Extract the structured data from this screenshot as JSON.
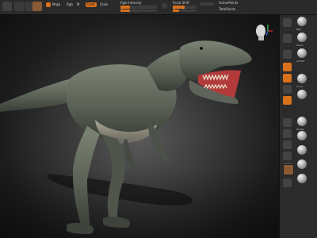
{
  "toolbar": {
    "buttons": [
      "Edit",
      "Draw",
      "Move",
      "Scale",
      "Rotate"
    ],
    "mrgb_label": "Mrgb",
    "rgb_label": "Rgb",
    "m_label": "M",
    "zadd_label": "Zadd",
    "zsub_label": "Zsub",
    "focal_shift_label": "Focal Shift",
    "draw_size_label": "Draw Size",
    "rgb_intensity_label": "Rgb Intensity",
    "z_intensity_label": "Z Intensity",
    "active_points_label": "ActivePoints",
    "total_points_label": "TotalPoints",
    "focal_shift_value": 0,
    "draw_size_value": 64,
    "rgb_intensity_value": 0.25,
    "z_intensity_value": 0.25,
    "colors": {
      "accent": "#d8701c",
      "material_swatch": "#8a5a35"
    }
  },
  "dock": {
    "items": [
      "BPR",
      "SPix",
      "Scroll",
      "Zoom",
      "Actual",
      "AAHalf",
      "Persp",
      "Floor",
      "Local",
      "L.Sym",
      "Frame",
      "Move",
      "Scale",
      "Rotate",
      "Transp",
      "Ghost",
      "Solo",
      "Xpose"
    ]
  },
  "viewport": {
    "model": "tyrannosaurus-rex",
    "gizmo": "head-gizmo-icon"
  }
}
